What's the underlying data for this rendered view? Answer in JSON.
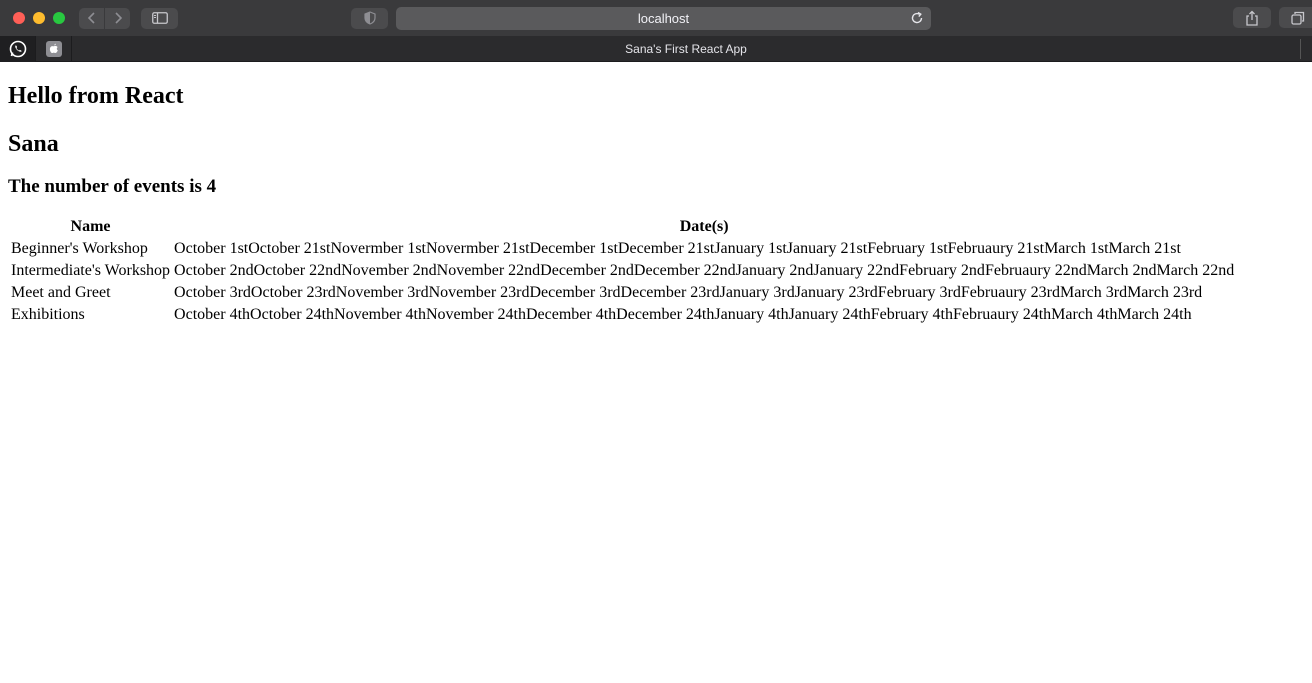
{
  "browser": {
    "url": "localhost",
    "tab_title": "Sana's First React App"
  },
  "page": {
    "heading": "Hello from React",
    "name": "Sana",
    "events_count_text": "The number of events is 4",
    "table": {
      "headers": [
        "Name",
        "Date(s)"
      ],
      "rows": [
        {
          "name": "Beginner's Workshop",
          "dates": [
            "October 1st",
            "October 21st",
            "Novermber 1st",
            "Novermber 21st",
            "December 1st",
            "December 21st",
            "January 1st",
            "January 21st",
            "February 1st",
            "Februaury 21st",
            "March 1st",
            "March 21st"
          ]
        },
        {
          "name": "Intermediate's Workshop",
          "dates": [
            "October 2nd",
            "October 22nd",
            "November 2nd",
            "November 22nd",
            "December 2nd",
            "December 22nd",
            "January 2nd",
            "January 22nd",
            "February 2nd",
            "Februaury 22nd",
            "March 2nd",
            "March 22nd"
          ]
        },
        {
          "name": "Meet and Greet",
          "dates": [
            "October 3rd",
            "October 23rd",
            "November 3rd",
            "November 23rd",
            "December 3rd",
            "December 23rd",
            "January 3rd",
            "January 23rd",
            "February 3rd",
            "Februaury 23rd",
            "March 3rd",
            "March 23rd"
          ]
        },
        {
          "name": "Exhibitions",
          "dates": [
            "October 4th",
            "October 24th",
            "November 4th",
            "November 24th",
            "December 4th",
            "December 24th",
            "January 4th",
            "January 24th",
            "February 4th",
            "Februaury 24th",
            "March 4th",
            "March 24th"
          ]
        }
      ]
    }
  }
}
